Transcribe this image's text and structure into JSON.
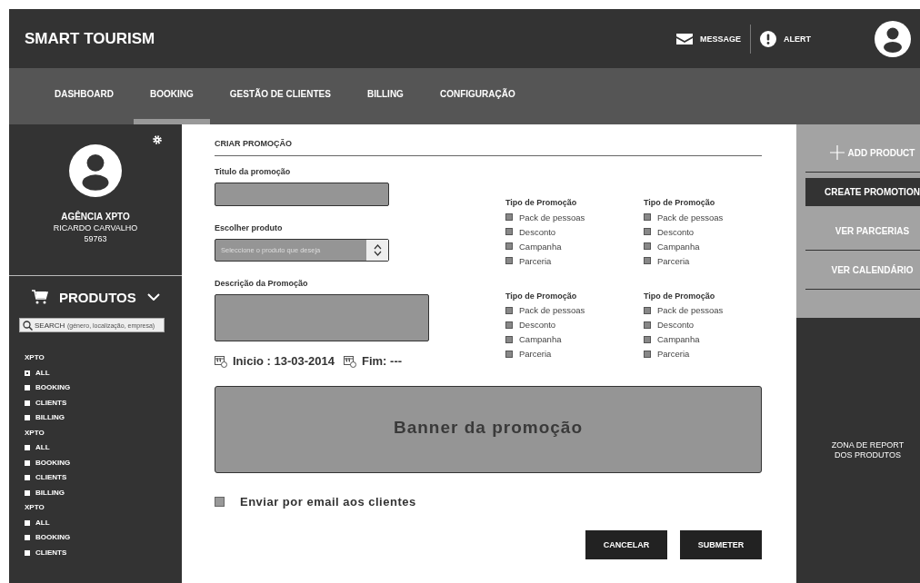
{
  "header": {
    "title": "SMART TOURISM",
    "actions": [
      {
        "kind": "message",
        "label": "MESSAGE"
      },
      {
        "kind": "alert",
        "label": "ALERT"
      }
    ]
  },
  "nav": [
    {
      "label": "DASHBOARD",
      "selected": false
    },
    {
      "label": "BOOKING",
      "selected": true
    },
    {
      "label": "GESTÃO DE CLIENTES",
      "selected": false
    },
    {
      "label": "BILLING",
      "selected": false
    },
    {
      "label": "CONFIGURAÇÃO",
      "selected": false
    }
  ],
  "profile": {
    "agency": "AGÊNCIA XPTO",
    "name": "RICARDO CARVALHO",
    "number": "59763"
  },
  "products": {
    "title": "PRODUTOS",
    "search": {
      "placeholder": "SEARCH",
      "hint": "(género, localização, empresa)"
    },
    "groups": [
      {
        "title": "XPTO",
        "items": [
          {
            "label": "ALL",
            "checked": true
          },
          {
            "label": "BOOKING",
            "checked": false
          },
          {
            "label": "CLIENTS",
            "checked": false
          },
          {
            "label": "BILLING",
            "checked": false
          }
        ]
      },
      {
        "title": "XPTO",
        "items": [
          {
            "label": "ALL",
            "checked": false
          },
          {
            "label": "BOOKING",
            "checked": false
          },
          {
            "label": "CLIENTS",
            "checked": false
          },
          {
            "label": "BILLING",
            "checked": false
          }
        ]
      },
      {
        "title": "XPTO",
        "items": [
          {
            "label": "ALL",
            "checked": false
          },
          {
            "label": "BOOKING",
            "checked": false
          },
          {
            "label": "CLIENTS",
            "checked": false
          }
        ]
      }
    ]
  },
  "form": {
    "title": "CRIAR PROMOÇÃO",
    "title_label": "Titulo da promoção",
    "product_label": "Escolher produto",
    "product_placeholder": "Seleccione o produto que deseja",
    "description_label": "Descrição da Promoção",
    "start": "Inicio : 13-03-2014",
    "end": "Fim: ---",
    "types": [
      {
        "title": "Tipo de Promoção",
        "options": [
          {
            "label": "Pack de pessoas",
            "checked": false
          },
          {
            "label": "Desconto",
            "checked": false
          },
          {
            "label": "Campanha",
            "checked": false
          },
          {
            "label": "Parceria",
            "checked": false
          }
        ]
      },
      {
        "title": "Tipo de Promoção",
        "options": [
          {
            "label": "Pack de pessoas",
            "checked": false
          },
          {
            "label": "Desconto",
            "checked": false
          },
          {
            "label": "Campanha",
            "checked": false
          },
          {
            "label": "Parceria",
            "checked": false
          }
        ]
      },
      {
        "title": "Tipo de Promoção",
        "options": [
          {
            "label": "Pack de pessoas",
            "checked": false
          },
          {
            "label": "Desconto",
            "checked": false
          },
          {
            "label": "Campanha",
            "checked": false
          },
          {
            "label": "Parceria",
            "checked": false
          }
        ]
      },
      {
        "title": "Tipo de Promoção",
        "options": [
          {
            "label": "Pack de pessoas",
            "checked": false
          },
          {
            "label": "Desconto",
            "checked": false
          },
          {
            "label": "Campanha",
            "checked": false
          },
          {
            "label": "Parceria",
            "checked": false
          }
        ]
      }
    ],
    "banner": "Banner da promoção",
    "email": {
      "label": "Enviar por email aos clientes",
      "checked": false
    },
    "buttons": [
      "CANCELAR",
      "SUBMETER"
    ]
  },
  "actions": [
    {
      "label": "ADD PRODUCT",
      "kind": "add",
      "selected": false
    },
    {
      "label": "CREATE PROMOTION",
      "kind": "plain",
      "selected": true
    },
    {
      "label": "VER PARCERIAS",
      "kind": "plain",
      "selected": false
    },
    {
      "label": "VER CALENDÁRIO",
      "kind": "plain",
      "selected": false
    }
  ],
  "report": "ZONA DE REPORT DOS PRODUTOS"
}
